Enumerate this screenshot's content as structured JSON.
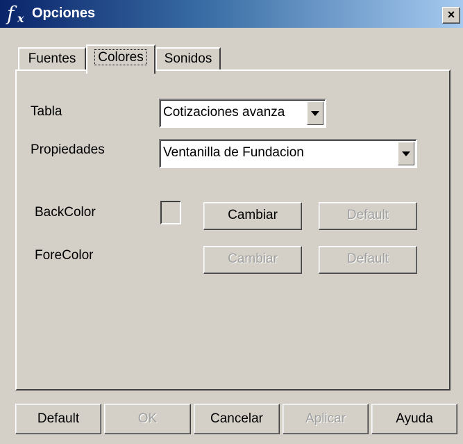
{
  "window": {
    "title": "Opciones",
    "close_label": "×"
  },
  "tabs": [
    {
      "label": "Fuentes"
    },
    {
      "label": "Colores",
      "active": true
    },
    {
      "label": "Sonidos"
    }
  ],
  "form": {
    "tabla_label": "Tabla",
    "tabla_value": "Cotizaciones avanza",
    "propiedades_label": "Propiedades",
    "propiedades_value": "Ventanilla de Fundacion",
    "backcolor_label": "BackColor",
    "forecolor_label": "ForeColor",
    "cambiar_label": "Cambiar",
    "default_label": "Default"
  },
  "footer": {
    "default_label": "Default",
    "ok_label": "OK",
    "cancelar_label": "Cancelar",
    "aplicar_label": "Aplicar",
    "ayuda_label": "Ayuda"
  },
  "colors": {
    "titlebar_start": "#0a246a",
    "titlebar_end": "#a6caf0",
    "face": "#d4d0c8",
    "disabled_text": "#a0a0a0"
  }
}
